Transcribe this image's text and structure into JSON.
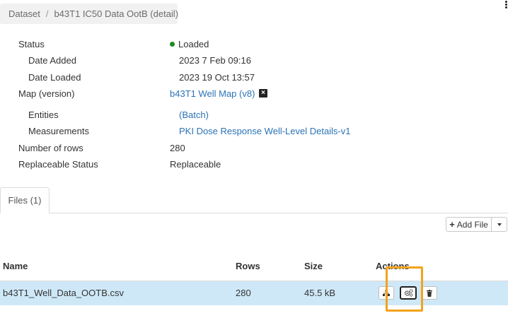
{
  "breadcrumb": {
    "root": "Dataset",
    "separator": "/",
    "current": "b43T1 IC50 Data OotB (detail)"
  },
  "properties": {
    "status_label": "Status",
    "status_value": "Loaded",
    "date_added_label": "Date Added",
    "date_added_value": "2023 7 Feb 09:16",
    "date_loaded_label": "Date Loaded",
    "date_loaded_value": "2023 19 Oct 13:57",
    "map_label": "Map (version)",
    "map_value": "b43T1 Well Map (v8)",
    "entities_label": "Entities",
    "entities_value": "(Batch)",
    "measurements_label": "Measurements",
    "measurements_value": "PKI Dose Response Well-Level Details-v1",
    "rows_label": "Number of rows",
    "rows_value": "280",
    "replaceable_label": "Replaceable Status",
    "replaceable_value": "Replaceable"
  },
  "tabs": [
    {
      "label": "Files (1)"
    }
  ],
  "toolbar": {
    "add_file_label": "Add File",
    "add_file_icon": "plus-icon"
  },
  "files_table": {
    "headers": {
      "name": "Name",
      "rows": "Rows",
      "size": "Size",
      "actions": "Actions"
    },
    "rows": [
      {
        "name": "b43T1_Well_Data_OOTB.csv",
        "rows": "280",
        "size": "45.5 kB"
      }
    ]
  },
  "actions": [
    "sitemap-icon",
    "gears-icon",
    "trash-icon"
  ],
  "colors": {
    "link": "#2b73b6",
    "status_ok": "#1e8a1e",
    "row_selected": "#cfe8f8",
    "highlight": "#f2a31b"
  }
}
